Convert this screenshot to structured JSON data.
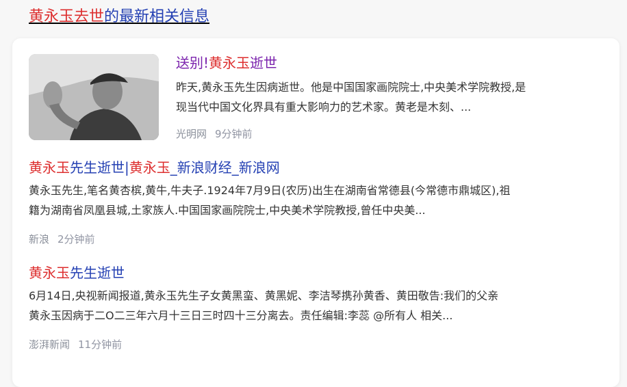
{
  "header": {
    "query": "黄永玉去世",
    "suffix": "的最新相关信息"
  },
  "results": [
    {
      "title_parts": [
        "送别!",
        "黄永玉",
        "逝世"
      ],
      "snippet_lines": [
        "昨天,黄永玉先生因病逝世。他是中国国家画院院士,中央美术学院教授,是",
        "现当代中国文化界具有重大影响力的艺术家。黄老是木刻、..."
      ],
      "source": "光明网",
      "time": "9分钟前"
    },
    {
      "title_parts": [
        "黄永玉",
        "先生逝世|",
        "黄永玉",
        "_新浪财经_新浪网"
      ],
      "snippet_lines": [
        "黄永玉先生,笔名黄杏槟,黄牛,牛夫子.1924年7月9日(农历)出生在湖南省常德县(今常德市鼎城区),祖",
        "籍为湖南省凤凰县城,土家族人.中国国家画院院士,中央美术学院教授,曾任中央美..."
      ],
      "source": "新浪",
      "time": "2分钟前"
    },
    {
      "title_parts": [
        "黄永玉",
        "先生逝世"
      ],
      "snippet_lines": [
        "6月14日,央视新闻报道,黄永玉先生子女黄黑蛮、黄黑妮、李洁琴携孙黄香、黄田敬告:我们的父亲",
        "黄永玉因病于二O二三年六月十三日三时四十三分离去。责任编辑:李蕊 @所有人 相关..."
      ],
      "source": "澎湃新闻",
      "time": "11分钟前"
    }
  ],
  "colors": {
    "highlight": "#dd2f2f",
    "link": "#2440b3",
    "visited": "#7b23ad",
    "meta": "#9195a3"
  }
}
